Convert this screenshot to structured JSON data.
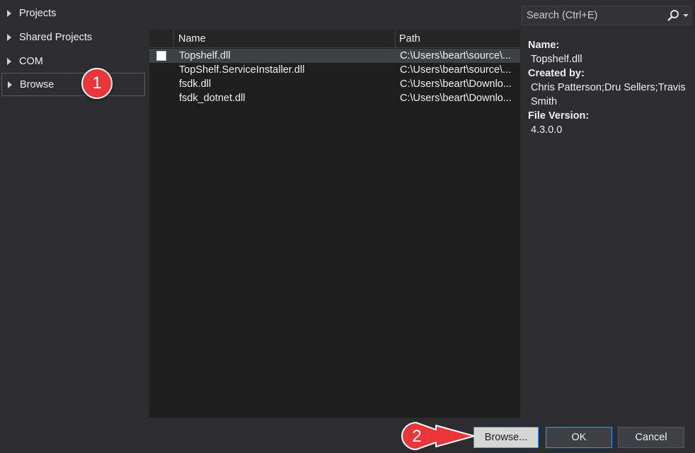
{
  "tree": {
    "items": [
      {
        "label": "Projects"
      },
      {
        "label": "Shared Projects"
      },
      {
        "label": "COM"
      },
      {
        "label": "Browse"
      }
    ]
  },
  "list": {
    "columns": {
      "name": "Name",
      "path": "Path"
    },
    "rows": [
      {
        "checked": false,
        "name": "Topshelf.dll",
        "path": "C:\\Users\\beart\\source\\..."
      },
      {
        "name": "TopShelf.ServiceInstaller.dll",
        "path": "C:\\Users\\beart\\source\\..."
      },
      {
        "name": "fsdk.dll",
        "path": "C:\\Users\\beart\\Downlo..."
      },
      {
        "name": "fsdk_dotnet.dll",
        "path": "C:\\Users\\beart\\Downlo..."
      }
    ]
  },
  "search": {
    "placeholder": "Search (Ctrl+E)"
  },
  "details": {
    "name_label": "Name:",
    "name_value": "Topshelf.dll",
    "created_label": "Created by:",
    "created_value": "Chris Patterson;Dru Sellers;Travis Smith",
    "version_label": "File Version:",
    "version_value": "4.3.0.0"
  },
  "footer": {
    "browse_label": "Browse...",
    "ok_label": "OK",
    "cancel_label": "Cancel"
  },
  "annotations": {
    "step1": "1",
    "step2": "2"
  },
  "colors": {
    "background": "#2d2d30",
    "list_background": "#1e1e1e",
    "badge": "#e8363a",
    "focus_border": "#3399ff"
  }
}
